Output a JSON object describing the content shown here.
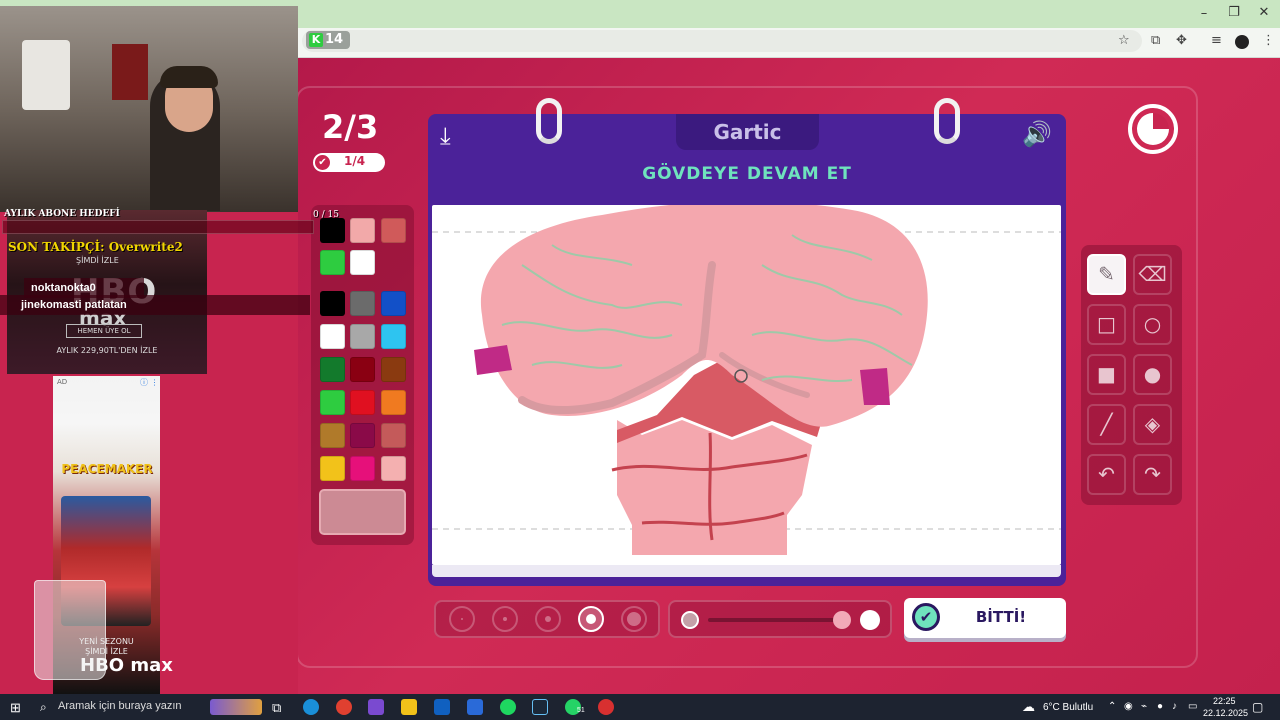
{
  "browser": {
    "tab_count": "14",
    "site_letter": "K"
  },
  "game": {
    "round": "2/3",
    "sub_progress": "1/4",
    "logo": "Gartic",
    "prompt": "GÖVDEYE DEVAM ET",
    "done_label": "BİTTİ!",
    "timer_remaining_fraction": 0.75,
    "palette": {
      "counter": "0  / 15",
      "colors": [
        "#000000",
        "#f2a9a9",
        "#d05a5a",
        "#2ecc40",
        "#ffffff",
        "#000000",
        "#6b6b6b",
        "#1250c8",
        "#ffffff",
        "#a8a8a8",
        "#2ec4f0",
        "#137a2c",
        "#8a0012",
        "#8a3a10",
        "#2ecc40",
        "#e01020",
        "#f07a20",
        "#b07a2a",
        "#8a0a48",
        "#c45a5a",
        "#f2c21a",
        "#e6107a",
        "#f4b0b0"
      ],
      "selected_color": "#cc8a94"
    },
    "tools": [
      "pencil-icon",
      "eraser-icon",
      "rect-outline-icon",
      "circle-outline-icon",
      "rect-fill-icon",
      "circle-fill-icon",
      "line-icon",
      "bucket-icon",
      "undo-icon",
      "redo-icon"
    ],
    "brush_sizes_selected": 4,
    "opacity_value": 1.0
  },
  "stream_overlay": {
    "goal_label": "AYLIK ABONE HEDEFİ",
    "last_follower": "SON TAKİPÇİ: Overwrite2",
    "chat": [
      "noktanokta0",
      "jinekomasti patlatan"
    ],
    "hbo_ad": {
      "now": "ŞİMDİ İZLE",
      "logo": "HBO",
      "max": "max",
      "cta": "HEMEN ÜYE OL",
      "price": "AYLIK 229,90TL'DEN İZLE"
    },
    "peacemaker_ad": {
      "ad_label": "AD",
      "title": "PEACEMAKER",
      "season": "YENİ SEZONU",
      "watch": "ŞİMDİ İZLE",
      "brand": "HBO max"
    }
  },
  "taskbar": {
    "search_placeholder": "Aramak için buraya yazın",
    "weather": "6°C  Bulutlu",
    "time": "22:25",
    "date": "22.12.2025",
    "whatsapp_badge": "51"
  }
}
